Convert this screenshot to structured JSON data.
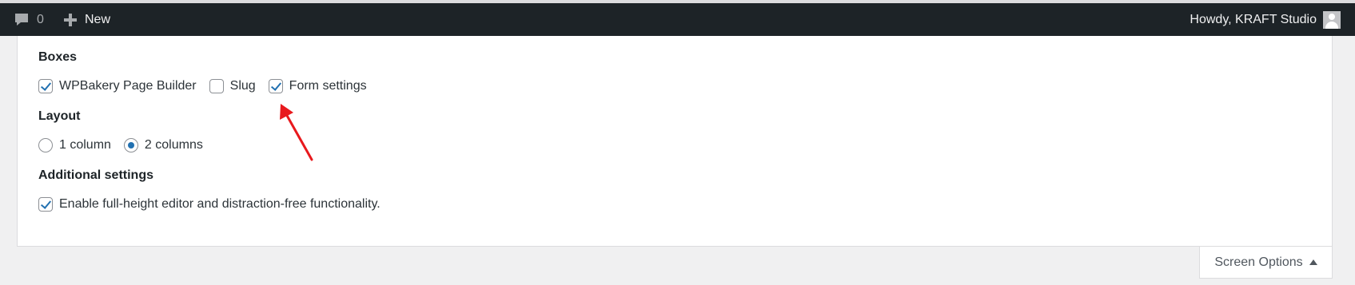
{
  "admin_bar": {
    "comments_count": "0",
    "comments_icon": "speech-bubble-icon",
    "new_label": "New",
    "new_icon": "plus-icon",
    "greeting": "Howdy, KRAFT Studio",
    "avatar_icon": "avatar-icon"
  },
  "boxes": {
    "legend": "Boxes",
    "items": [
      {
        "label": "WPBakery Page Builder",
        "checked": true
      },
      {
        "label": "Slug",
        "checked": false
      },
      {
        "label": "Form settings",
        "checked": true
      }
    ]
  },
  "layout": {
    "legend": "Layout",
    "options": [
      {
        "label": "1 column",
        "selected": false
      },
      {
        "label": "2 columns",
        "selected": true
      }
    ]
  },
  "additional": {
    "legend": "Additional settings",
    "items": [
      {
        "label": "Enable full-height editor and distraction-free functionality.",
        "checked": true
      }
    ]
  },
  "screen_options": {
    "label": "Screen Options",
    "icon": "caret-up-icon"
  },
  "annotation": {
    "color": "#e8191d",
    "icon": "red-arrow-annotation"
  }
}
